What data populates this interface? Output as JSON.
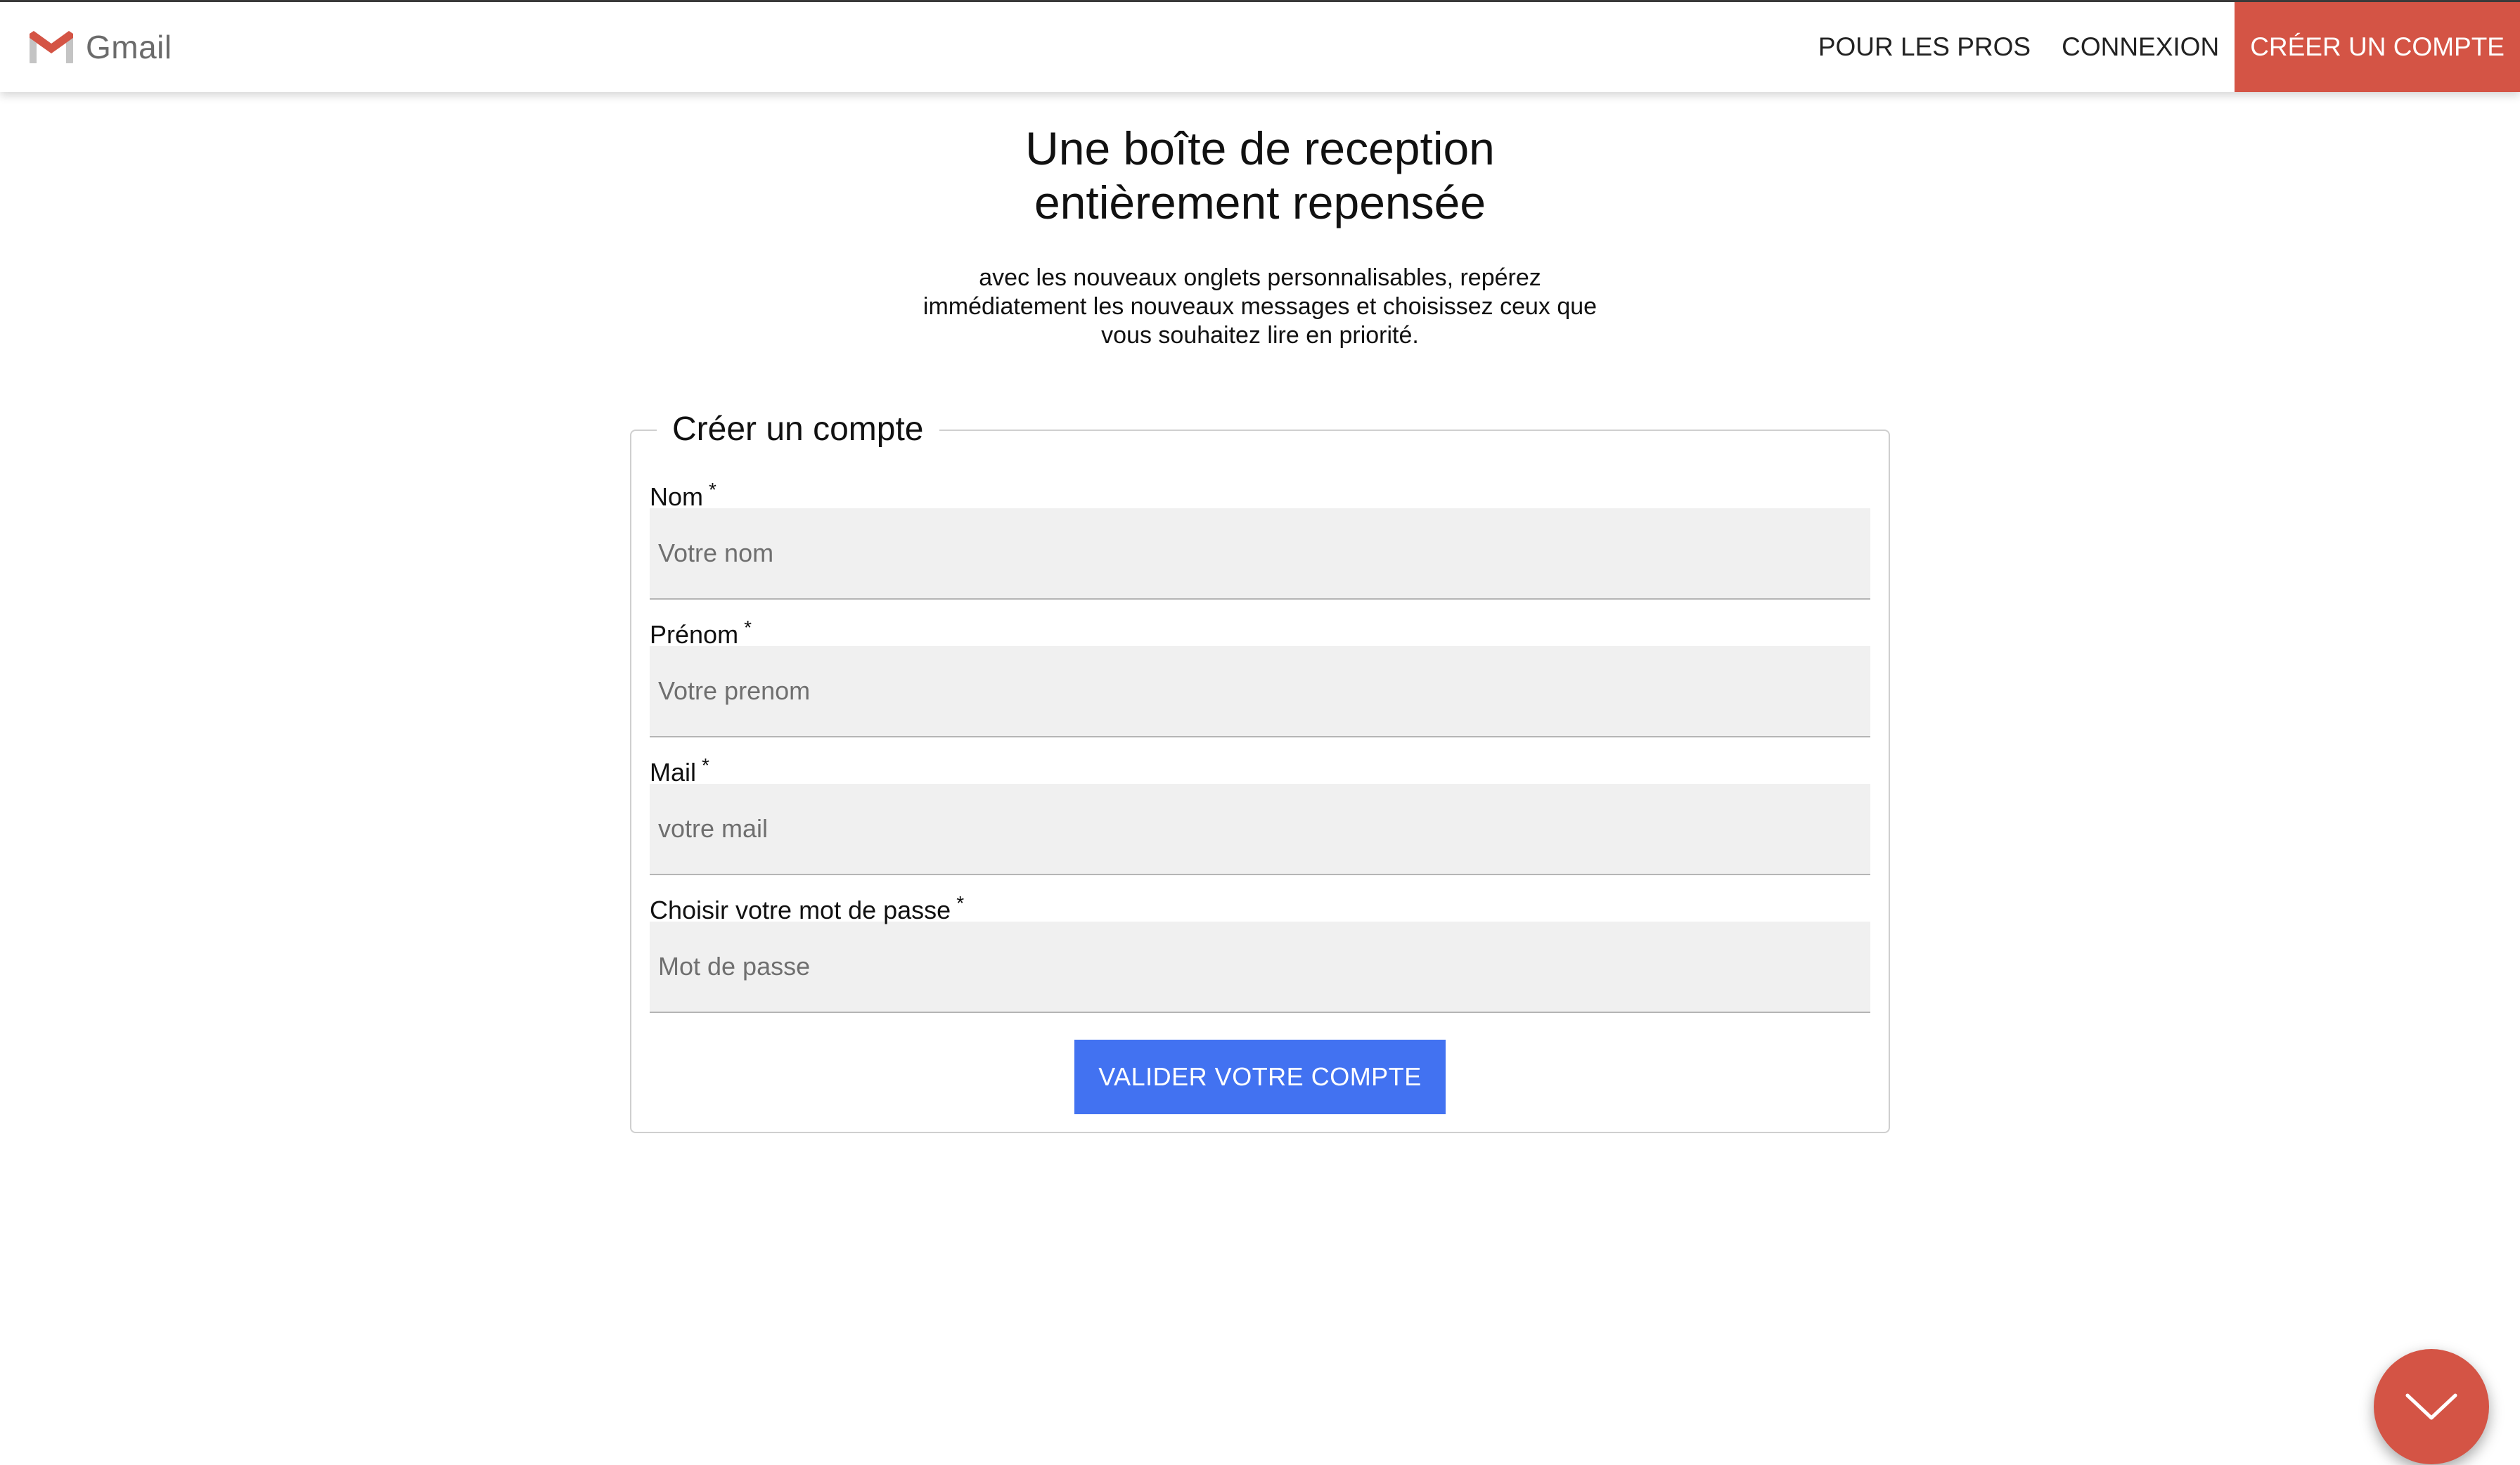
{
  "header": {
    "brand_name": "Gmail",
    "nav": [
      {
        "label": "POUR LES PROS"
      },
      {
        "label": "CONNEXION"
      },
      {
        "label": "CRÉER UN COMPTE"
      }
    ]
  },
  "hero": {
    "title_line1": "Une boîte de reception",
    "title_line2": "entièrement repensée",
    "subtitle": "avec les nouveaux onglets personnalisables, repérez immédiatement les nouveaux messages et choisissez ceux que vous souhaitez lire en priorité."
  },
  "form": {
    "legend": "Créer un compte",
    "required_marker": "*",
    "fields": [
      {
        "label": "Nom",
        "placeholder": "Votre nom"
      },
      {
        "label": "Prénom",
        "placeholder": "Votre prenom"
      },
      {
        "label": "Mail",
        "placeholder": "votre mail"
      },
      {
        "label": "Choisir votre mot de passe",
        "placeholder": "Mot de passe"
      }
    ],
    "submit_label": "VALIDER VOTRE COMPTE"
  },
  "colors": {
    "brand_red": "#d45445",
    "primary_blue": "#4272f1",
    "input_bg": "#f0f0f0"
  },
  "icons": {
    "logo": "gmail-logo-icon",
    "fab": "chevron-down-icon"
  }
}
